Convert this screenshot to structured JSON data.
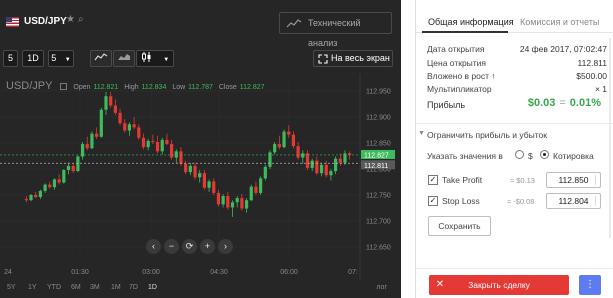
{
  "header": {
    "pair": "USD/JPY",
    "tech_analysis": "Технический анализ"
  },
  "toolbar": {
    "period_value": "5",
    "timeframe": "1D",
    "interval": "5",
    "fullscreen": "На весь экран"
  },
  "chart": {
    "legend_symbol": "USD/JPY",
    "open_label": "Open",
    "open": "112.821",
    "high_label": "High",
    "high": "112.834",
    "low_label": "Low",
    "low": "112.787",
    "close_label": "Close",
    "close": "112.827",
    "price_ticks": [
      "112.950",
      "112.900",
      "112.850",
      "112.800",
      "112.750",
      "112.700",
      "112.650"
    ],
    "time_ticks": [
      "24",
      "01:30",
      "03:00",
      "04:30",
      "06:00",
      "07:"
    ],
    "current_price_tag": "112.827",
    "open_price_tag": "112.811",
    "colors": {
      "up": "#3dbb5d",
      "down": "#e53935",
      "bg": "#262626"
    }
  },
  "chart_data": {
    "type": "candlestick",
    "ylim": [
      112.625,
      112.975
    ],
    "ticks": [
      112.65,
      112.7,
      112.75,
      112.8,
      112.85,
      112.9,
      112.95
    ],
    "current_price": 112.827,
    "open_price": 112.811,
    "candles": [
      [
        112.742,
        112.748,
        112.736,
        112.74
      ],
      [
        112.74,
        112.752,
        112.738,
        112.75
      ],
      [
        112.75,
        112.756,
        112.744,
        112.746
      ],
      [
        112.746,
        112.76,
        112.742,
        112.758
      ],
      [
        112.758,
        112.772,
        112.754,
        112.77
      ],
      [
        112.77,
        112.776,
        112.762,
        112.765
      ],
      [
        112.765,
        112.782,
        112.76,
        112.78
      ],
      [
        112.78,
        112.79,
        112.77,
        112.774
      ],
      [
        112.774,
        112.8,
        112.772,
        112.798
      ],
      [
        112.798,
        112.812,
        112.79,
        112.806
      ],
      [
        112.806,
        112.81,
        112.792,
        112.796
      ],
      [
        112.796,
        112.826,
        112.794,
        112.824
      ],
      [
        112.824,
        112.852,
        112.818,
        112.848
      ],
      [
        112.848,
        112.862,
        112.836,
        112.84
      ],
      [
        112.84,
        112.872,
        112.838,
        112.868
      ],
      [
        112.868,
        112.88,
        112.858,
        112.862
      ],
      [
        112.862,
        112.918,
        112.86,
        112.914
      ],
      [
        112.914,
        112.948,
        112.904,
        112.94
      ],
      [
        112.94,
        112.948,
        112.918,
        112.922
      ],
      [
        112.922,
        112.934,
        112.904,
        112.908
      ],
      [
        112.908,
        112.916,
        112.884,
        112.888
      ],
      [
        112.888,
        112.896,
        112.87,
        112.874
      ],
      [
        112.874,
        112.89,
        112.864,
        112.886
      ],
      [
        112.886,
        112.9,
        112.876,
        112.88
      ],
      [
        112.88,
        112.886,
        112.856,
        112.86
      ],
      [
        112.86,
        112.868,
        112.838,
        112.842
      ],
      [
        112.842,
        112.858,
        112.836,
        112.854
      ],
      [
        112.854,
        112.866,
        112.848,
        112.852
      ],
      [
        112.852,
        112.864,
        112.83,
        112.834
      ],
      [
        112.834,
        112.86,
        112.828,
        112.856
      ],
      [
        112.856,
        112.868,
        112.846,
        112.848
      ],
      [
        112.848,
        112.856,
        112.818,
        112.822
      ],
      [
        112.822,
        112.838,
        112.812,
        112.834
      ],
      [
        112.834,
        112.842,
        112.806,
        112.81
      ],
      [
        112.81,
        112.816,
        112.79,
        112.794
      ],
      [
        112.794,
        112.812,
        112.788,
        112.806
      ],
      [
        112.806,
        112.812,
        112.78,
        112.784
      ],
      [
        112.784,
        112.798,
        112.774,
        112.792
      ],
      [
        112.792,
        112.798,
        112.76,
        112.764
      ],
      [
        112.764,
        112.78,
        112.756,
        112.776
      ],
      [
        112.776,
        112.782,
        112.75,
        112.754
      ],
      [
        112.754,
        112.76,
        112.728,
        112.732
      ],
      [
        112.732,
        112.752,
        112.726,
        112.748
      ],
      [
        112.748,
        112.756,
        112.722,
        112.726
      ],
      [
        112.726,
        112.74,
        112.708,
        112.736
      ],
      [
        112.736,
        112.748,
        112.726,
        112.744
      ],
      [
        112.744,
        112.752,
        112.72,
        112.724
      ],
      [
        112.724,
        112.744,
        112.716,
        112.74
      ],
      [
        112.74,
        112.77,
        112.738,
        112.766
      ],
      [
        112.766,
        112.776,
        112.75,
        112.754
      ],
      [
        112.754,
        112.786,
        112.75,
        112.782
      ],
      [
        112.782,
        112.808,
        112.778,
        112.804
      ],
      [
        112.804,
        112.836,
        112.8,
        112.832
      ],
      [
        112.832,
        112.852,
        112.828,
        112.848
      ],
      [
        112.848,
        112.864,
        112.838,
        112.842
      ],
      [
        112.842,
        112.876,
        112.84,
        112.872
      ],
      [
        112.872,
        112.884,
        112.86,
        112.866
      ],
      [
        112.866,
        112.872,
        112.84,
        112.844
      ],
      [
        112.844,
        112.852,
        112.818,
        112.822
      ],
      [
        112.822,
        112.836,
        112.81,
        112.83
      ],
      [
        112.83,
        112.836,
        112.798,
        112.802
      ],
      [
        112.802,
        112.82,
        112.796,
        112.816
      ],
      [
        112.816,
        112.824,
        112.788,
        112.792
      ],
      [
        112.792,
        112.812,
        112.786,
        112.808
      ],
      [
        112.808,
        112.816,
        112.784,
        112.788
      ],
      [
        112.788,
        112.8,
        112.778,
        112.796
      ],
      [
        112.796,
        112.824,
        112.79,
        112.82
      ],
      [
        112.82,
        112.83,
        112.806,
        112.812
      ],
      [
        112.812,
        112.836,
        112.808,
        112.83
      ],
      [
        112.83,
        112.834,
        112.818,
        112.827
      ]
    ]
  },
  "controls": [
    "‹",
    "−",
    "⟳",
    "+",
    "›"
  ],
  "periods": [
    "5Y",
    "1Y",
    "YTD",
    "6M",
    "3M",
    "1M",
    "7D",
    "1D"
  ],
  "log_label": "лог",
  "info": {
    "tab_general": "Общая информация",
    "tab_fees": "Комиссия и отчеты",
    "rows": [
      {
        "label": "Дата открытия",
        "value": "24 фев 2017, 07:02:47"
      },
      {
        "label": "Цена открытия",
        "value": "112.811"
      },
      {
        "label": "Вложено в рост ↑",
        "value": "$500.00"
      },
      {
        "label": "Мультипликатор",
        "value": "× 1"
      }
    ],
    "profit_label": "Прибыль",
    "profit_amount": "$0.03",
    "profit_eq": "=",
    "profit_pct": "0.01%",
    "limit_title": "Ограничить прибыль и убыток",
    "specify_label": "Указать значения в",
    "radio_dollar": "$",
    "radio_quote": "Котировка",
    "take_profit_label": "Take Profit",
    "take_profit_approx": "≈ $0.13",
    "take_profit_value": "112.850",
    "stop_loss_label": "Stop Loss",
    "stop_loss_approx": "≈ -$0.08",
    "stop_loss_value": "112.804",
    "save": "Сохранить",
    "close_deal": "Закрыть сделку",
    "more": "⋮",
    "close_x": "✕",
    "check": "✓"
  }
}
